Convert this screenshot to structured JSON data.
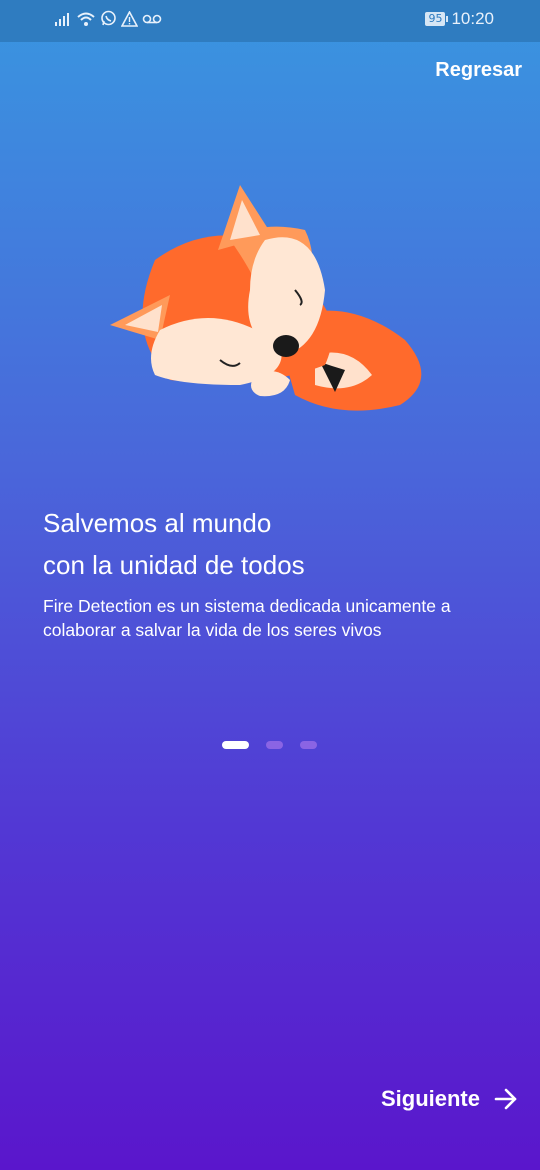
{
  "status_bar": {
    "battery": "95",
    "time": "10:20",
    "icons": [
      "signal-icon",
      "wifi-icon",
      "whatsapp-icon",
      "warning-icon",
      "voicemail-icon"
    ]
  },
  "header": {
    "back_label": "Regresar"
  },
  "illustration": {
    "name": "sleeping-fox-illustration"
  },
  "main": {
    "title_line1": "Salvemos al mundo",
    "title_line2": "con la unidad de todos",
    "description": "Fire Detection es un sistema dedicada unicamente a colaborar a salvar la vida de los seres vivos"
  },
  "pager": {
    "current": 1,
    "total": 3
  },
  "footer": {
    "next_label": "Siguiente"
  },
  "colors": {
    "gradient_top": "#3996e0",
    "gradient_bottom": "#5a16cc",
    "fox_orange": "#ff6a2c"
  }
}
